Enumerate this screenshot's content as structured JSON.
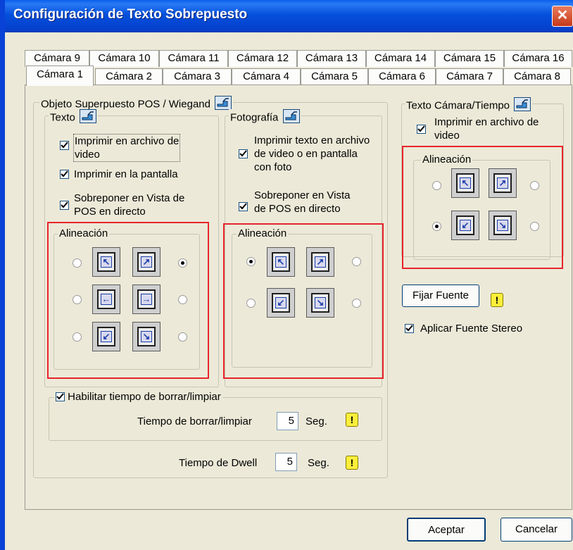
{
  "window": {
    "title": "Configuración de Texto Sobrepuesto",
    "close": "✕"
  },
  "tabs_row1": [
    "Cámara 9",
    "Cámara 10",
    "Cámara 11",
    "Cámara 12",
    "Cámara 13",
    "Cámara 14",
    "Cámara 15",
    "Cámara 16"
  ],
  "tabs_row2": [
    "Cámara 1",
    "Cámara 2",
    "Cámara 3",
    "Cámara 4",
    "Cámara 5",
    "Cámara 6",
    "Cámara 7",
    "Cámara 8"
  ],
  "pos_group": {
    "title": "Objeto Superpuesto POS / Wiegand",
    "texto": {
      "title": "Texto",
      "opt1": "Imprimir en archivo de",
      "opt1b": "video",
      "opt2": "Imprimir en la pantalla",
      "opt3": "Sobreponer en Vista de",
      "opt3b": "POS en directo",
      "alignment_title": "Alineación"
    },
    "foto": {
      "title": "Fotografía",
      "opt1": "Imprimir texto en archivo",
      "opt1b": "de video o en pantalla",
      "opt1c": "con foto",
      "opt2": "Sobreponer en Vista",
      "opt2b": "de POS en directo",
      "alignment_title": "Alineación"
    },
    "clear": {
      "title": "Habilitar tiempo de borrar/limpiar",
      "label": "Tiempo de borrar/limpiar",
      "value": "5",
      "unit": "Seg."
    },
    "dwell": {
      "label": "Tiempo de Dwell",
      "value": "5",
      "unit": "Seg."
    }
  },
  "cam_time_group": {
    "title": "Texto Cámara/Tiempo",
    "opt1": "Imprimir en archivo de",
    "opt1b": "video",
    "alignment_title": "Alineación"
  },
  "font_button": "Fijar Fuente",
  "stereo": "Aplicar Fuente Stereo",
  "ok": "Aceptar",
  "cancel": "Cancelar",
  "warn_glyph": "!",
  "colors": {
    "title_bar": "#0550dc",
    "highlight_border": "#e8242b",
    "warning": "#ffef3a"
  }
}
